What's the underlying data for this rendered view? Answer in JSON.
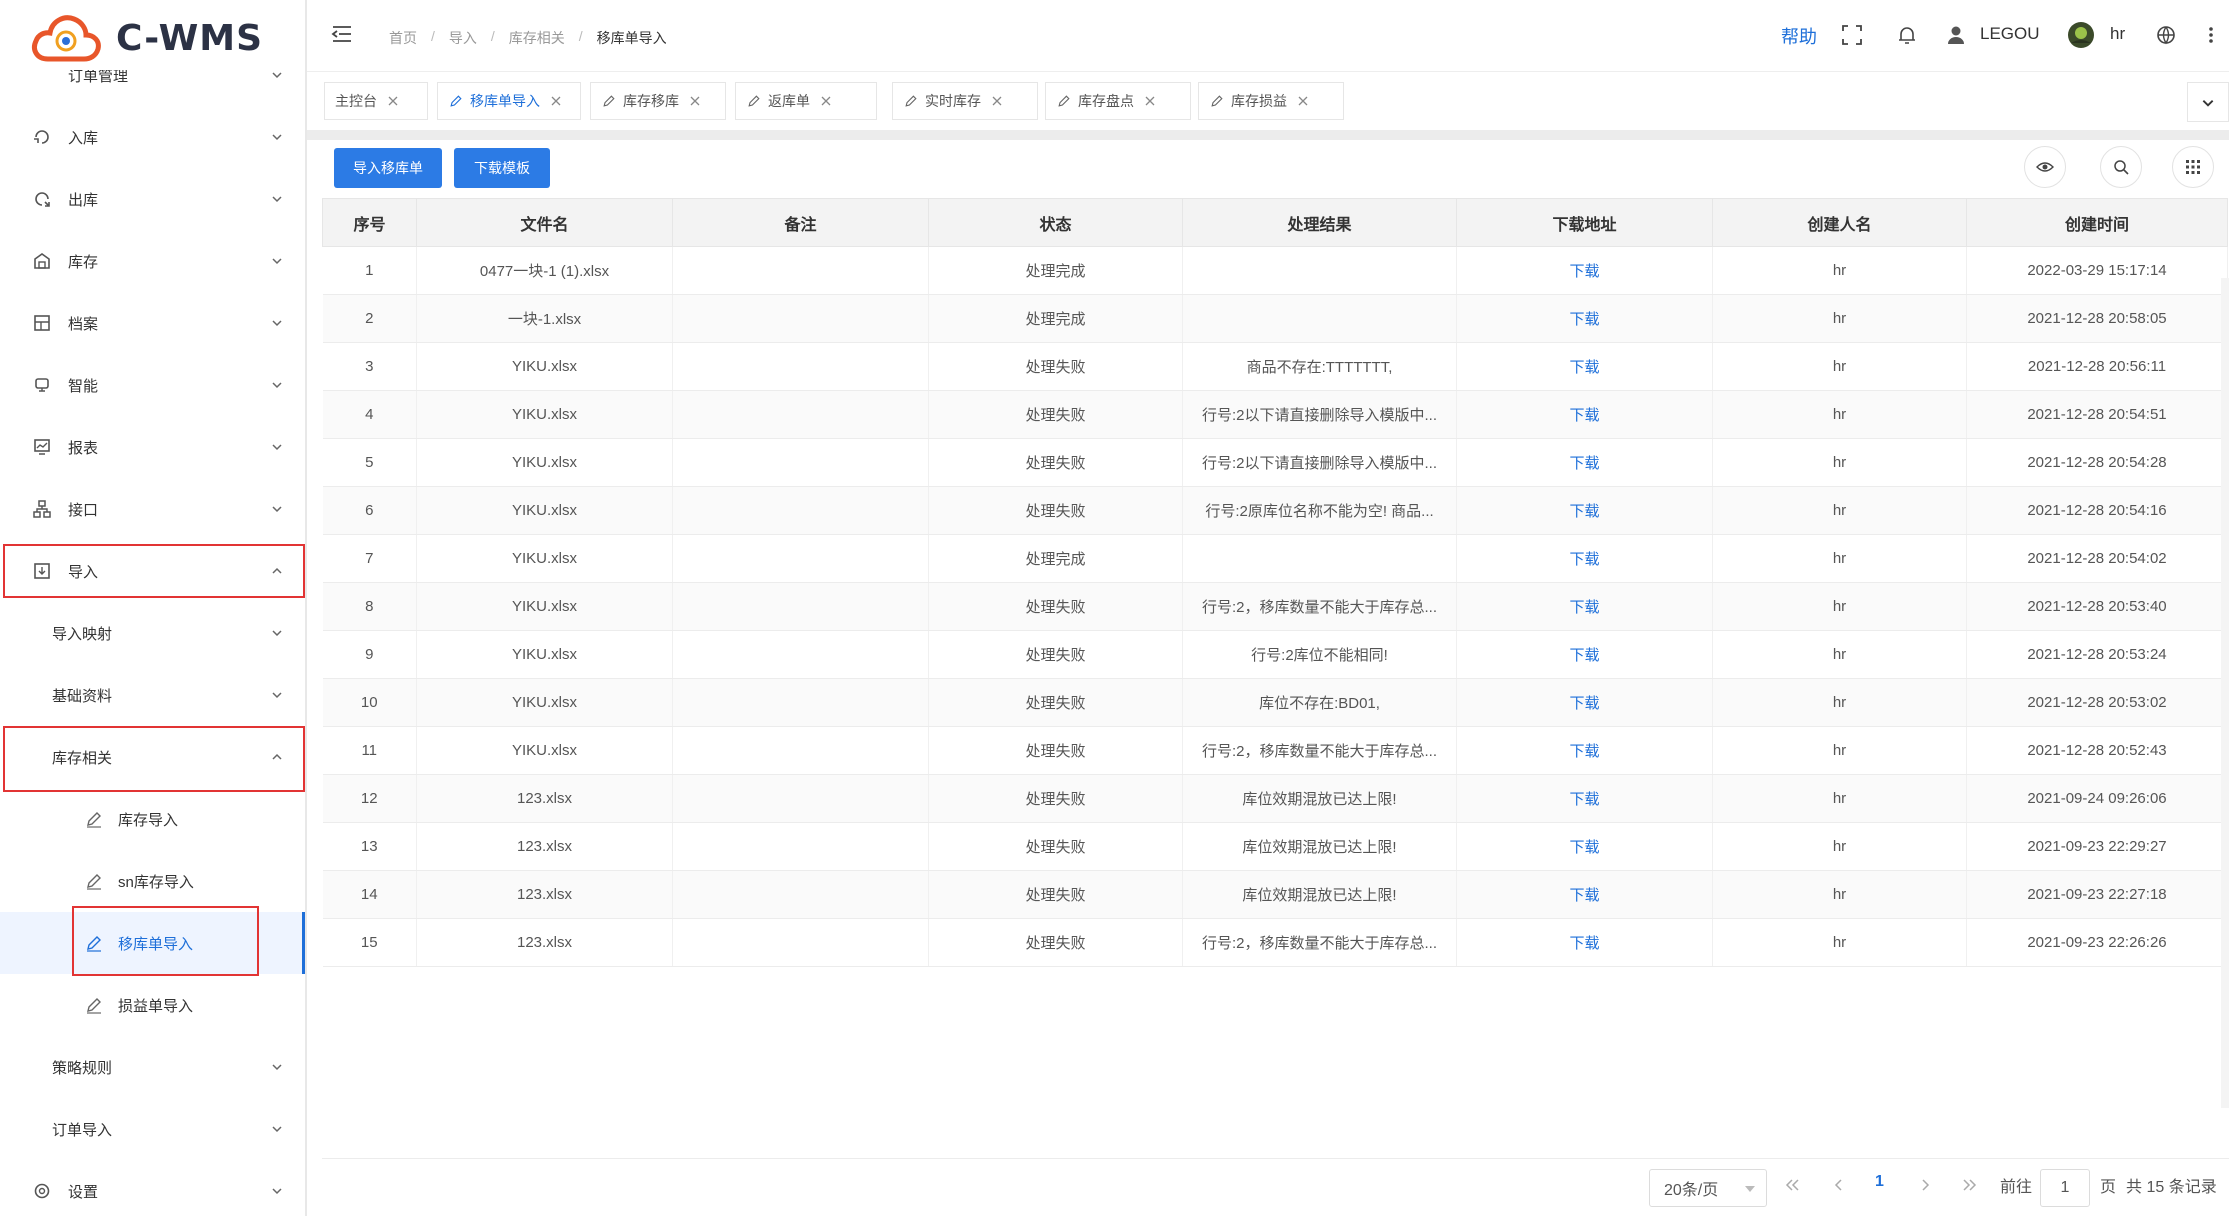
{
  "app": {
    "brand": "C-WMS"
  },
  "header": {
    "breadcrumb": [
      "首页",
      "导入",
      "库存相关",
      "移库单导入"
    ],
    "help": "帮助",
    "user_org": "LEGOU",
    "user_name": "hr"
  },
  "sidebar": {
    "partial_item": "订单管理",
    "items": [
      {
        "label": "入库",
        "icon": "inbound-icon"
      },
      {
        "label": "出库",
        "icon": "outbound-icon"
      },
      {
        "label": "库存",
        "icon": "warehouse-icon"
      },
      {
        "label": "档案",
        "icon": "archive-icon"
      },
      {
        "label": "智能",
        "icon": "smart-icon"
      },
      {
        "label": "报表",
        "icon": "report-icon"
      },
      {
        "label": "接口",
        "icon": "interface-icon"
      },
      {
        "label": "导入",
        "icon": "import-icon"
      }
    ],
    "import_sub": [
      "导入映射",
      "基础资料",
      "库存相关"
    ],
    "stock_leaf": [
      "库存导入",
      "sn库存导入",
      "移库单导入",
      "损益单导入"
    ],
    "after_sub": [
      "策略规则",
      "订单导入"
    ],
    "settings": "设置"
  },
  "tabs": [
    "主控台",
    "移库单导入",
    "库存移库",
    "返库单",
    "实时库存",
    "库存盘点",
    "库存损益"
  ],
  "toolbar": {
    "import_btn": "导入移库单",
    "template_btn": "下载模板"
  },
  "table": {
    "columns": [
      "序号",
      "文件名",
      "备注",
      "状态",
      "处理结果",
      "下载地址",
      "创建人名",
      "创建时间"
    ],
    "rows": [
      [
        "1",
        "0477一块-1 (1).xlsx",
        "",
        "处理完成",
        "",
        "下载",
        "hr",
        "2022-03-29 15:17:14"
      ],
      [
        "2",
        "一块-1.xlsx",
        "",
        "处理完成",
        "",
        "下载",
        "hr",
        "2021-12-28 20:58:05"
      ],
      [
        "3",
        "YIKU.xlsx",
        "",
        "处理失败",
        "商品不存在:TTTTTTT,",
        "下载",
        "hr",
        "2021-12-28 20:56:11"
      ],
      [
        "4",
        "YIKU.xlsx",
        "",
        "处理失败",
        "行号:2以下请直接删除导入模版中...",
        "下载",
        "hr",
        "2021-12-28 20:54:51"
      ],
      [
        "5",
        "YIKU.xlsx",
        "",
        "处理失败",
        "行号:2以下请直接删除导入模版中...",
        "下载",
        "hr",
        "2021-12-28 20:54:28"
      ],
      [
        "6",
        "YIKU.xlsx",
        "",
        "处理失败",
        "行号:2原库位名称不能为空! 商品...",
        "下载",
        "hr",
        "2021-12-28 20:54:16"
      ],
      [
        "7",
        "YIKU.xlsx",
        "",
        "处理完成",
        "",
        "下载",
        "hr",
        "2021-12-28 20:54:02"
      ],
      [
        "8",
        "YIKU.xlsx",
        "",
        "处理失败",
        "行号:2，移库数量不能大于库存总...",
        "下载",
        "hr",
        "2021-12-28 20:53:40"
      ],
      [
        "9",
        "YIKU.xlsx",
        "",
        "处理失败",
        "行号:2库位不能相同!",
        "下载",
        "hr",
        "2021-12-28 20:53:24"
      ],
      [
        "10",
        "YIKU.xlsx",
        "",
        "处理失败",
        "库位不存在:BD01,",
        "下载",
        "hr",
        "2021-12-28 20:53:02"
      ],
      [
        "11",
        "YIKU.xlsx",
        "",
        "处理失败",
        "行号:2，移库数量不能大于库存总...",
        "下载",
        "hr",
        "2021-12-28 20:52:43"
      ],
      [
        "12",
        "123.xlsx",
        "",
        "处理失败",
        "库位效期混放已达上限!",
        "下载",
        "hr",
        "2021-09-24 09:26:06"
      ],
      [
        "13",
        "123.xlsx",
        "",
        "处理失败",
        "库位效期混放已达上限!",
        "下载",
        "hr",
        "2021-09-23 22:29:27"
      ],
      [
        "14",
        "123.xlsx",
        "",
        "处理失败",
        "库位效期混放已达上限!",
        "下载",
        "hr",
        "2021-09-23 22:27:18"
      ],
      [
        "15",
        "123.xlsx",
        "",
        "处理失败",
        "行号:2，移库数量不能大于库存总...",
        "下载",
        "hr",
        "2021-09-23 22:26:26"
      ]
    ]
  },
  "pagination": {
    "page_size": "20条/页",
    "current": "1",
    "goto_label": "前往",
    "goto_value": "1",
    "page_unit": "页",
    "total": "共 15 条记录"
  },
  "colors": {
    "primary": "#2c7be5",
    "link": "#1e6fd9",
    "highlight_box": "#e23434"
  }
}
